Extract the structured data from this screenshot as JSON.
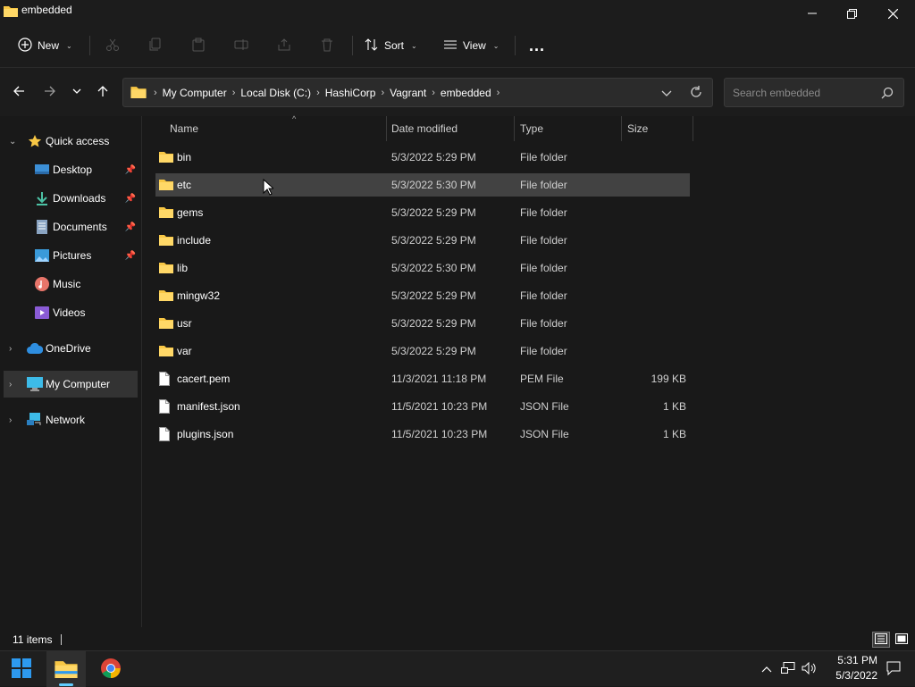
{
  "window": {
    "title": "embedded"
  },
  "toolbar": {
    "new_label": "New",
    "sort_label": "Sort",
    "view_label": "View",
    "more_label": "..."
  },
  "address": {
    "crumbs": [
      "My Computer",
      "Local Disk (C:)",
      "HashiCorp",
      "Vagrant",
      "embedded"
    ]
  },
  "search": {
    "placeholder": "Search embedded"
  },
  "sidebar": {
    "items": [
      {
        "label": "Quick access"
      },
      {
        "label": "Desktop"
      },
      {
        "label": "Downloads"
      },
      {
        "label": "Documents"
      },
      {
        "label": "Pictures"
      },
      {
        "label": "Music"
      },
      {
        "label": "Videos"
      },
      {
        "label": "OneDrive"
      },
      {
        "label": "My Computer"
      },
      {
        "label": "Network"
      }
    ]
  },
  "columns": {
    "name": "Name",
    "date": "Date modified",
    "type": "Type",
    "size": "Size"
  },
  "files": [
    {
      "name": "bin",
      "date": "5/3/2022 5:29 PM",
      "type": "File folder",
      "size": ""
    },
    {
      "name": "etc",
      "date": "5/3/2022 5:30 PM",
      "type": "File folder",
      "size": ""
    },
    {
      "name": "gems",
      "date": "5/3/2022 5:29 PM",
      "type": "File folder",
      "size": ""
    },
    {
      "name": "include",
      "date": "5/3/2022 5:29 PM",
      "type": "File folder",
      "size": ""
    },
    {
      "name": "lib",
      "date": "5/3/2022 5:30 PM",
      "type": "File folder",
      "size": ""
    },
    {
      "name": "mingw32",
      "date": "5/3/2022 5:29 PM",
      "type": "File folder",
      "size": ""
    },
    {
      "name": "usr",
      "date": "5/3/2022 5:29 PM",
      "type": "File folder",
      "size": ""
    },
    {
      "name": "var",
      "date": "5/3/2022 5:29 PM",
      "type": "File folder",
      "size": ""
    },
    {
      "name": "cacert.pem",
      "date": "11/3/2021 11:18 PM",
      "type": "PEM File",
      "size": "199 KB"
    },
    {
      "name": "manifest.json",
      "date": "11/5/2021 10:23 PM",
      "type": "JSON File",
      "size": "1 KB"
    },
    {
      "name": "plugins.json",
      "date": "11/5/2021 10:23 PM",
      "type": "JSON File",
      "size": "1 KB"
    }
  ],
  "status": {
    "item_count": "11 items"
  },
  "clock": {
    "time": "5:31 PM",
    "date": "5/3/2022"
  },
  "colors": {
    "folder": "#f8c745",
    "accent": "#60cdff",
    "hover_row": "#424242"
  }
}
